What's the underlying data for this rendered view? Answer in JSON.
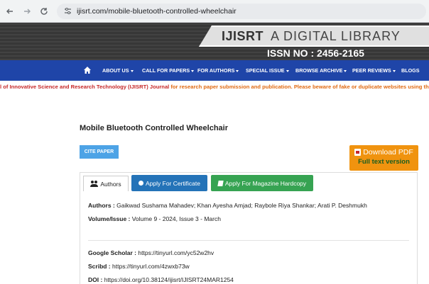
{
  "browser": {
    "url": "ijisrt.com/mobile-bluetooth-controlled-wheelchair"
  },
  "banner": {
    "logo_main": "IJISRT",
    "logo_sub": "A DIGITAL LIBRARY",
    "issn": "ISSN NO : 2456-2165"
  },
  "nav": {
    "items": [
      {
        "label": "ABOUT US",
        "dropdown": true
      },
      {
        "label": "CALL FOR PAPERS",
        "dropdown": true
      },
      {
        "label": "FOR AUTHORS",
        "dropdown": true
      },
      {
        "label": "SPECIAL ISSUE",
        "dropdown": true
      },
      {
        "label": "BROWSE ARCHIVE",
        "dropdown": true
      },
      {
        "label": "PEER REVIEWS",
        "dropdown": true
      },
      {
        "label": "BLOGS",
        "dropdown": false
      }
    ]
  },
  "notice": {
    "link_text": "l of Innovative Science and Research Technology (IJISRT) Journal",
    "text": " for research paper submission and publication. Please beware of fake or duplicate websites using the IJI"
  },
  "article": {
    "title": "Mobile Bluetooth Controlled Wheelchair",
    "cite_label": "CITE PAPER",
    "pdf_top": "Download PDF",
    "pdf_bottom": "Full text version",
    "tabs": {
      "authors": "Authors",
      "certificate": "Apply For Certificate",
      "magazine": "Apply For Magazine Hardcopy"
    },
    "authors_label": "Authors :",
    "authors_value": "Gaikwad Sushama Mahadev; Khan Ayesha Amjad; Raybole Riya Shankar; Arati P. Deshmukh",
    "volume_label": "Volume/Issue :",
    "volume_value": "Volume 9 - 2024, Issue 3 - March",
    "scholar_label": "Google Scholar :",
    "scholar_value": "https://tinyurl.com/yc52w2hv",
    "scribd_label": "Scribd :",
    "scribd_value": "https://tinyurl.com/4zwxb73w",
    "doi_label": "DOI :",
    "doi_value": "https://doi.org/10.38124/ijisrt/IJISRT24MAR1254"
  },
  "colors": {
    "nav_bg": "#1f45a8",
    "cite_btn": "#4da3e6",
    "pdf_btn": "#f0930f",
    "cert_btn": "#2473b8",
    "mag_btn": "#36a352",
    "notice": "#e06a12"
  }
}
